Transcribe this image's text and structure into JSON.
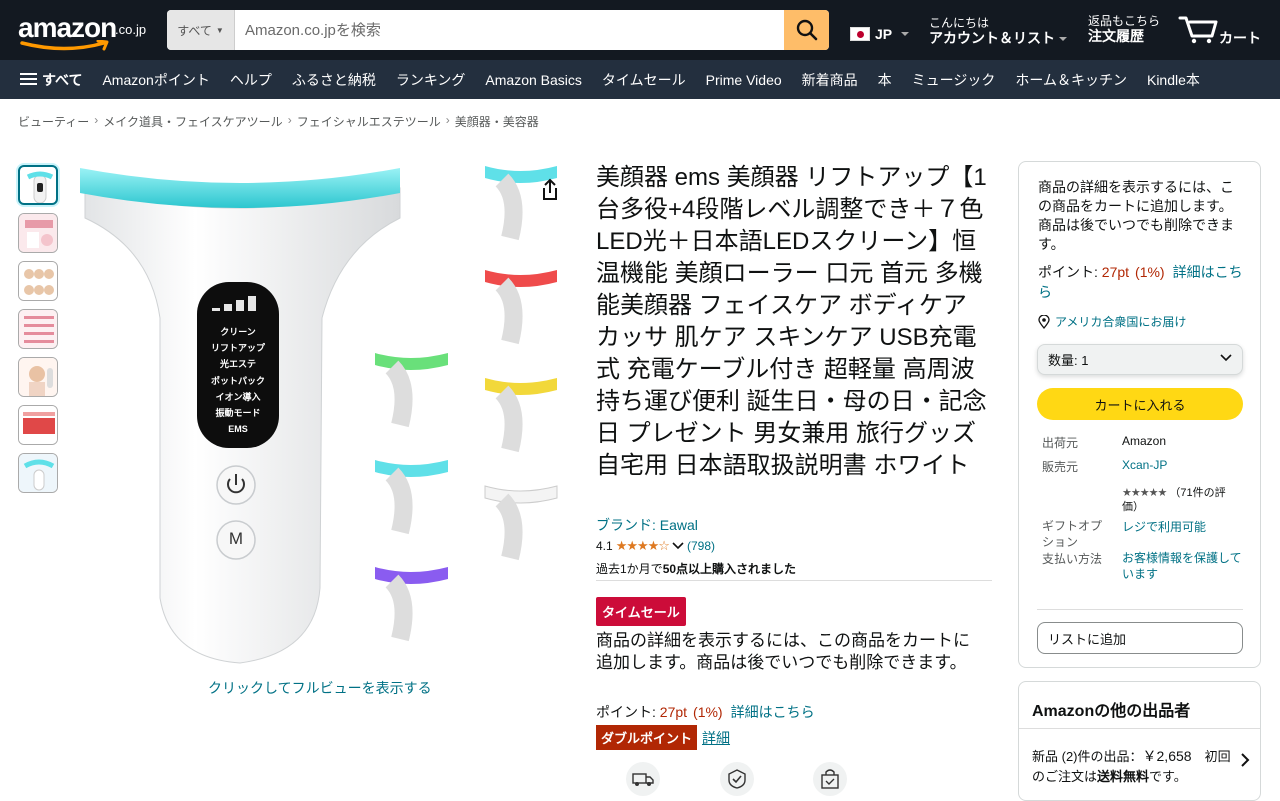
{
  "header": {
    "logo_text": "amazon",
    "logo_suffix": ".co.jp",
    "search_category": "すべて",
    "search_placeholder": "Amazon.co.jpを検索",
    "lang": "JP",
    "greeting": "こんにちは",
    "account": "アカウント＆リスト",
    "orders_small": "返品もこちら",
    "orders": "注文履歴",
    "cart": "カート",
    "cart_count": "0"
  },
  "nav": {
    "all": "すべて",
    "items": [
      "Amazonポイント",
      "ヘルプ",
      "ふるさと納税",
      "ランキング",
      "Amazon Basics",
      "タイムセール",
      "Prime Video",
      "新着商品",
      "本",
      "ミュージック",
      "ホーム＆キッチン",
      "Kindle本"
    ]
  },
  "breadcrumb": [
    "ビューティー",
    "メイク道具・フェイスケアツール",
    "フェイシャルエステツール",
    "美顔器・美容器"
  ],
  "gallery": {
    "zoom_text": "クリックしてフルビューを表示する",
    "screen_labels": [
      "クリーン",
      "リフトアップ",
      "光エステ",
      "ポットパック",
      "イオン導入",
      "振動モード",
      "EMS"
    ],
    "button_m": "M",
    "led_colors": [
      "#5fe0e8",
      "#69e07a",
      "#ef4b4b",
      "#f2d83a",
      "#8a5cf0",
      "#ffffff"
    ]
  },
  "product": {
    "title": "美顔器 ems 美顔器 リフトアップ【1台多役+4段階レベル調整でき＋７色LED光＋日本語LEDスクリーン】恒温機能 美顔ローラー 口元 首元 多機能美顔器 フェイスケア ボディケア カッサ 肌ケア スキンケア USB充電式 充電ケーブル付き 超軽量 高周波 持ち運び便利 誕生日・母の日・記念日 プレゼント 男女兼用 旅行グッズ 自宅用 日本語取扱説明書 ホワイト",
    "brand": "ブランド: Eawal",
    "rating_value": "4.1",
    "rating_count": "(798)",
    "bought_prefix": "過去1か月で",
    "bought_bold": "50点以上購入されました",
    "deal_badge": "タイムセール",
    "cart_message": "商品の詳細を表示するには、この商品をカートに追加します。商品は後でいつでも削除できます。",
    "points_label": "ポイント: ",
    "points_value": "27pt",
    "points_pct": "(1%)",
    "points_link": "詳細はこちら",
    "double_point": "ダブルポイント",
    "double_link": "詳細"
  },
  "buybox": {
    "message": "商品の詳細を表示するには、この商品をカートに追加します。商品は後でいつでも削除できます。",
    "points_label": "ポイント: ",
    "points_value": "27pt",
    "points_pct": "(1%)",
    "points_link": "詳細はこちら",
    "deliver_to": "アメリカ合衆国にお届け",
    "quantity": "数量: 1",
    "add_to_cart": "カートに入れる",
    "shipper_k": "出荷元",
    "shipper_v": "Amazon",
    "seller_k": "販売元",
    "seller_v": "Xcan-JP",
    "seller_rating": "（71件の評価）",
    "gift_k": "ギフトオプション",
    "gift_v": "レジで利用可能",
    "pay_k": "支払い方法",
    "pay_v": "お客様情報を保護しています",
    "wishlist": "リストに追加"
  },
  "other_sellers": {
    "heading": "Amazonの他の出品者",
    "line_prefix": "新品 (2)件の出品：",
    "price": "￥2,658",
    "line_mid": "初回のご注文は",
    "free": "送料無料",
    "line_end": "です。"
  },
  "colors": {
    "header_bg": "#131921",
    "nav_bg": "#232f3e",
    "search_btn": "#febd69",
    "add_to_cart": "#ffd814",
    "deal": "#cc0c39",
    "link": "#007185",
    "price_red": "#b12704"
  }
}
